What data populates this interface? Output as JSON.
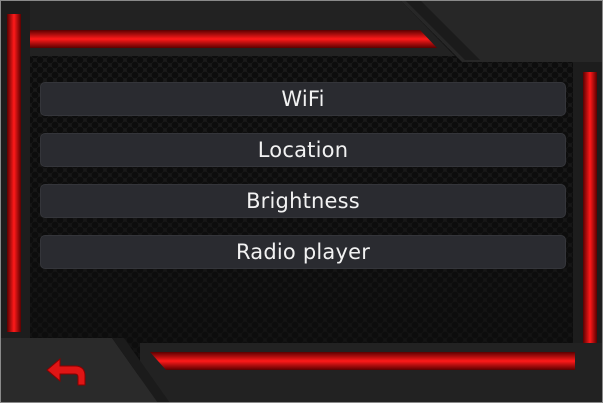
{
  "menu": {
    "items": [
      {
        "label": "WiFi"
      },
      {
        "label": "Location"
      },
      {
        "label": "Brightness"
      },
      {
        "label": "Radio player"
      }
    ]
  },
  "back": {
    "icon": "back-arrow-icon"
  },
  "colors": {
    "accent": "#e10000",
    "button_bg": "#2a2b30",
    "panel_dark": "#262626"
  }
}
